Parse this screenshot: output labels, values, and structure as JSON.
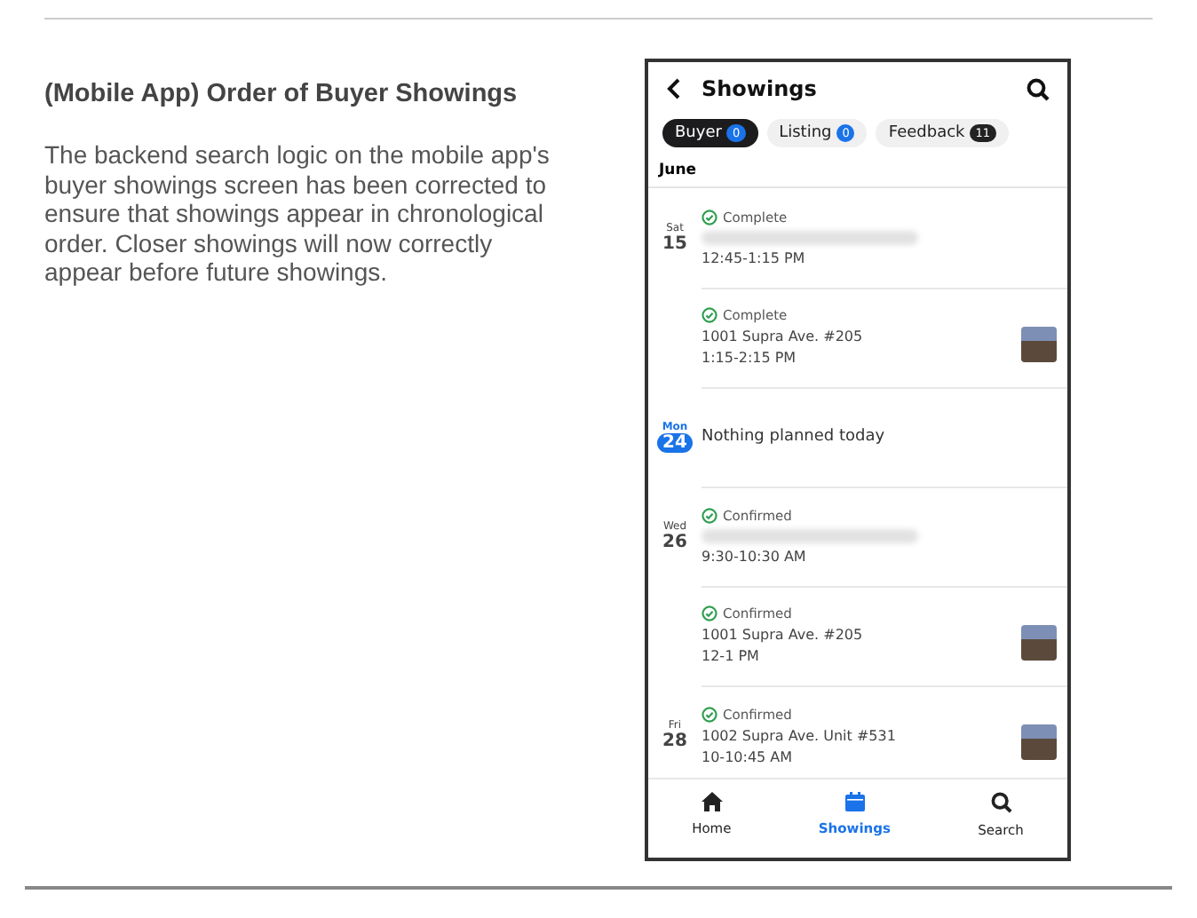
{
  "article": {
    "title": "(Mobile App) Order of Buyer Showings",
    "body": "The backend search logic on the mobile app's buyer showings screen has been corrected to ensure that showings appear in chronological order. Closer showings will now correctly appear before future showings."
  },
  "phone": {
    "title": "Showings",
    "month": "June",
    "tabs": [
      {
        "label": "Buyer",
        "count": "0",
        "selected": true,
        "color": "#1a73e8"
      },
      {
        "label": "Listing",
        "count": "0",
        "selected": false,
        "color": "#1a73e8"
      },
      {
        "label": "Feedback",
        "count": "11",
        "selected": false,
        "color": "#222222"
      }
    ],
    "entries": [
      {
        "kind": "showing",
        "day": "Sat",
        "date": "15",
        "today": false,
        "status": "Complete",
        "redacted": true,
        "time": "12:45-1:15 PM",
        "photo": false
      },
      {
        "kind": "showing",
        "status": "Complete",
        "redacted": false,
        "address": "1001 Supra Ave. #205",
        "time": "1:15-2:15 PM",
        "photo": true
      },
      {
        "kind": "empty",
        "day": "Mon",
        "date": "24",
        "today": true,
        "text": "Nothing planned today"
      },
      {
        "kind": "showing",
        "day": "Wed",
        "date": "26",
        "today": false,
        "status": "Confirmed",
        "redacted": true,
        "time": "9:30-10:30 AM",
        "photo": false
      },
      {
        "kind": "showing",
        "status": "Confirmed",
        "redacted": false,
        "address": "1001 Supra Ave. #205",
        "time": "12-1 PM",
        "photo": true
      },
      {
        "kind": "showing",
        "day": "Fri",
        "date": "28",
        "today": false,
        "status": "Confirmed",
        "redacted": false,
        "address": "1002 Supra Ave. Unit #531",
        "time": "10-10:45 AM",
        "photo": true
      }
    ],
    "nav": [
      {
        "label": "Home",
        "selected": false
      },
      {
        "label": "Showings",
        "selected": true
      },
      {
        "label": "Search",
        "selected": false
      }
    ]
  }
}
